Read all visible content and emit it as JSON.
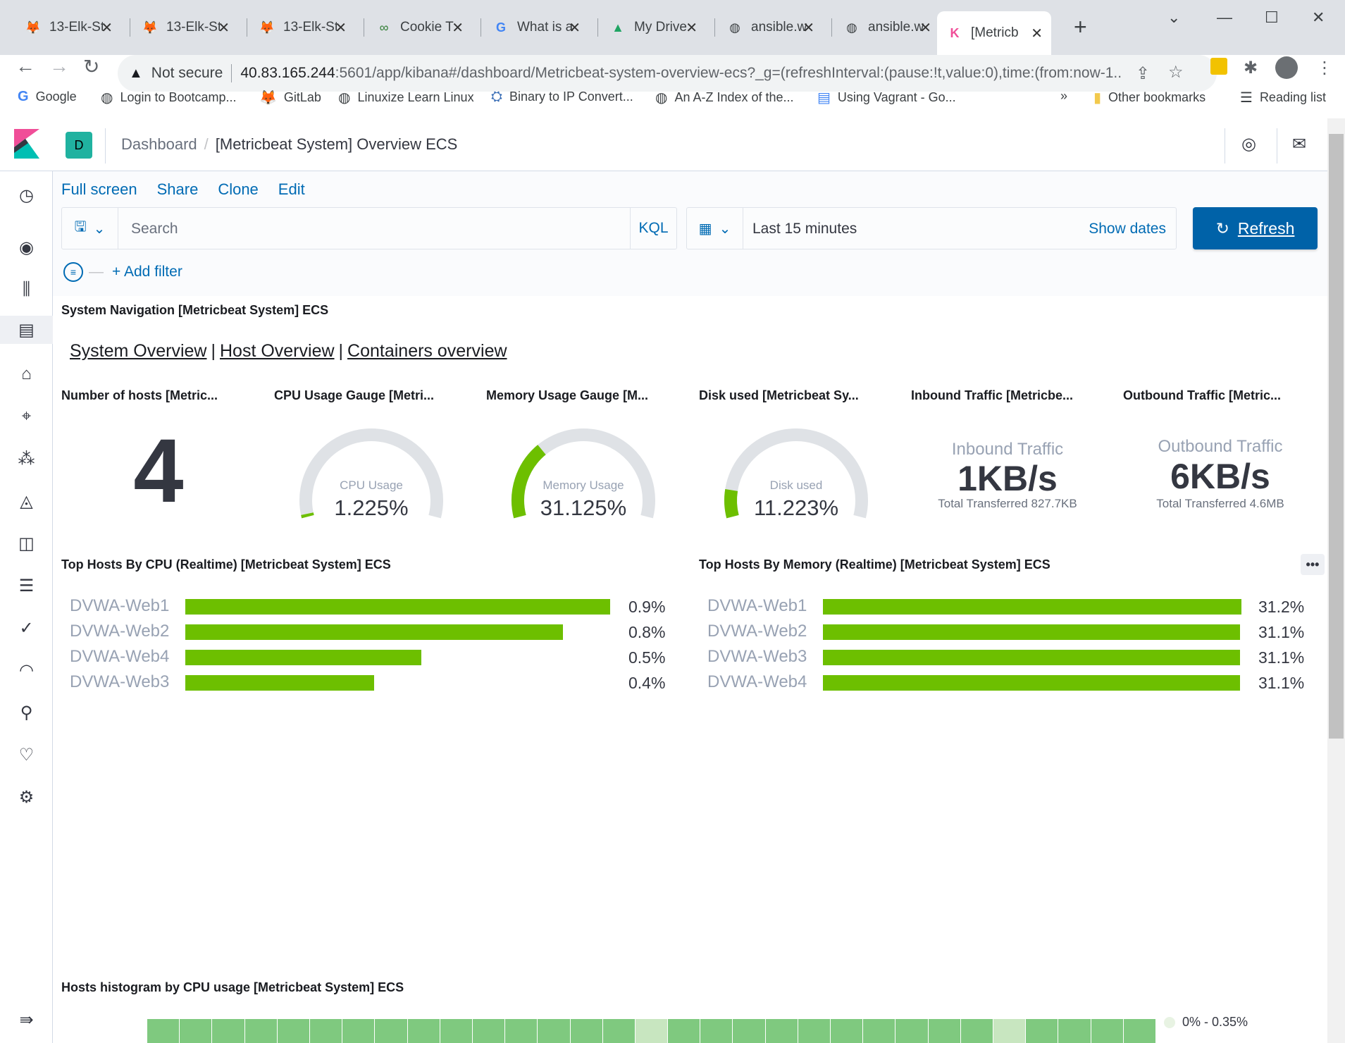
{
  "browser": {
    "tabs": [
      {
        "title": "13-Elk-St",
        "icon": "gitlab-icon"
      },
      {
        "title": "13-Elk-St",
        "icon": "gitlab-icon"
      },
      {
        "title": "13-Elk-St",
        "icon": "gitlab-icon"
      },
      {
        "title": "Cookie T",
        "icon": "cookie-icon"
      },
      {
        "title": "What is a",
        "icon": "google-icon"
      },
      {
        "title": "My Drive",
        "icon": "drive-icon"
      },
      {
        "title": "ansible.w",
        "icon": "globe-icon"
      },
      {
        "title": "ansible.w",
        "icon": "globe-icon"
      },
      {
        "title": "[Metricb",
        "icon": "kibana-icon",
        "active": true
      }
    ],
    "address": {
      "security": "Not secure",
      "host": "40.83.165.244",
      "path": ":5601/app/kibana#/dashboard/Metricbeat-system-overview-ecs?_g=(refreshInterval:(pause:!t,value:0),time:(from:now-1..."
    },
    "bookmarks": [
      {
        "label": "Google",
        "icon": "google-icon"
      },
      {
        "label": "Login to Bootcamp...",
        "icon": "globe-icon"
      },
      {
        "label": "GitLab",
        "icon": "gitlab-icon"
      },
      {
        "label": "Linuxize Learn Linux",
        "icon": "globe-icon"
      },
      {
        "label": "Binary to IP Convert...",
        "icon": "ufo-icon"
      },
      {
        "label": "An A-Z Index of the...",
        "icon": "globe-icon"
      },
      {
        "label": "Using Vagrant - Go...",
        "icon": "docs-icon"
      }
    ],
    "bookmarks_more": "»",
    "other_bookmarks": "Other bookmarks",
    "reading_list": "Reading list"
  },
  "kibana": {
    "space_initial": "D",
    "breadcrumb": {
      "parent": "Dashboard",
      "current": "[Metricbeat System] Overview ECS"
    },
    "top_menu": [
      "Full screen",
      "Share",
      "Clone",
      "Edit"
    ],
    "search_placeholder": "Search",
    "kql": "KQL",
    "time_range": "Last 15 minutes",
    "show_dates": "Show dates",
    "refresh": "Refresh",
    "add_filter": "+ Add filter",
    "accent": "#006bb4",
    "bar_color": "#6dbf00"
  },
  "panels": {
    "system_nav": {
      "title": "System Navigation [Metricbeat System] ECS",
      "links": [
        "System Overview",
        "Host Overview",
        "Containers overview"
      ]
    },
    "hosts": {
      "title": "Number of hosts [Metric...",
      "value": "4"
    },
    "cpu_gauge": {
      "title": "CPU Usage Gauge [Metri...",
      "label": "CPU Usage",
      "value": "1.225%",
      "fraction": 0.01225
    },
    "mem_gauge": {
      "title": "Memory Usage Gauge [M...",
      "label": "Memory Usage",
      "value": "31.125%",
      "fraction": 0.31125
    },
    "disk_gauge": {
      "title": "Disk used [Metricbeat Sy...",
      "label": "Disk used",
      "value": "11.223%",
      "fraction": 0.11223
    },
    "inbound": {
      "title": "Inbound Traffic [Metricbe...",
      "label": "Inbound Traffic",
      "value": "1KB/s",
      "sub": "Total Transferred 827.7KB"
    },
    "outbound": {
      "title": "Outbound Traffic [Metric...",
      "label": "Outbound Traffic",
      "value": "6KB/s",
      "sub": "Total Transferred 4.6MB"
    },
    "top_cpu": {
      "title": "Top Hosts By CPU (Realtime) [Metricbeat System] ECS",
      "rows": [
        {
          "host": "DVWA-Web1",
          "value": "0.9%",
          "pct": 0.9
        },
        {
          "host": "DVWA-Web2",
          "value": "0.8%",
          "pct": 0.8
        },
        {
          "host": "DVWA-Web4",
          "value": "0.5%",
          "pct": 0.5
        },
        {
          "host": "DVWA-Web3",
          "value": "0.4%",
          "pct": 0.4
        }
      ]
    },
    "top_mem": {
      "title": "Top Hosts By Memory (Realtime) [Metricbeat System] ECS",
      "rows": [
        {
          "host": "DVWA-Web1",
          "value": "31.2%",
          "pct": 31.2
        },
        {
          "host": "DVWA-Web2",
          "value": "31.1%",
          "pct": 31.1
        },
        {
          "host": "DVWA-Web3",
          "value": "31.1%",
          "pct": 31.1
        },
        {
          "host": "DVWA-Web4",
          "value": "31.1%",
          "pct": 31.1
        }
      ]
    },
    "histogram": {
      "title": "Hosts histogram by CPU usage [Metricbeat System] ECS",
      "legend": "0% - 0.35%",
      "cells": [
        1,
        1,
        1,
        1,
        1,
        1,
        1,
        1,
        1,
        1,
        1,
        1,
        1,
        1,
        1,
        0,
        1,
        1,
        1,
        1,
        1,
        1,
        1,
        1,
        1,
        1,
        0,
        1,
        1,
        1,
        1
      ]
    },
    "panel_menu": "•••"
  }
}
